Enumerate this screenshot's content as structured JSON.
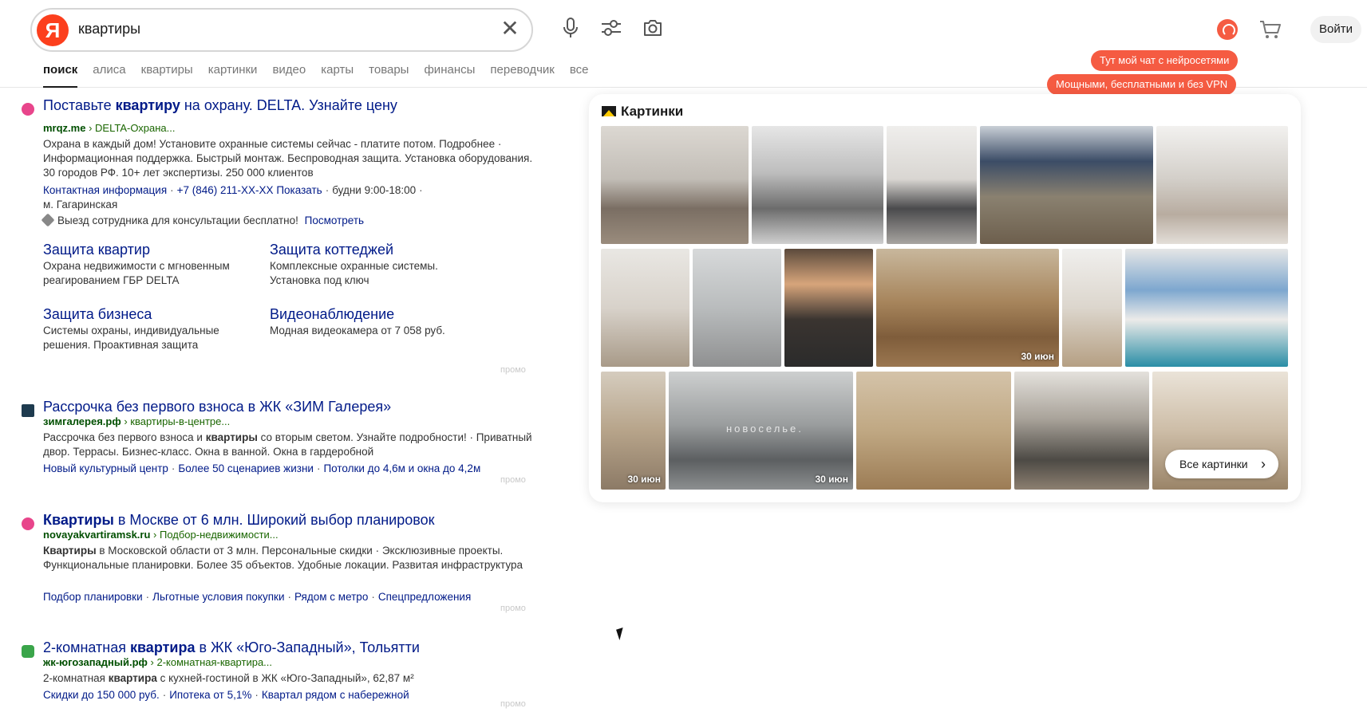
{
  "search": {
    "value": "квартиры",
    "logo": "Я"
  },
  "tabs": [
    "поиск",
    "алиса",
    "квартиры",
    "картинки",
    "видео",
    "карты",
    "товары",
    "финансы",
    "переводчик",
    "все"
  ],
  "header": {
    "login_label": "Войти"
  },
  "tooltip": {
    "line1": "Тут мой чат с нейросетями",
    "line2": "Мощными, бесплатными и без VPN"
  },
  "results": [
    {
      "title_pre": "Поставьте ",
      "title_bold": "квартиру",
      "title_post": " на охрану. DELTA. Узнайте цену",
      "domain": "mrqz.me",
      "path": " › DELTA-Охрана...",
      "desc": "Охрана в каждый дом! Установите охранные системы сейчас - платите потом. Подробнее · Информационная поддержка. Быстрый монтаж. Беспроводная защита. Установка оборудования. 30 городов РФ. 10+ лет экспертизы. 250 000 клиентов",
      "contact_link": "Контактная информация",
      "phone": "+7 (846) 211-XX-XX Показать",
      "hours": "будни 9:00-18:00",
      "metro": "м. Гагаринская",
      "offer": "Выезд сотрудника для консультации бесплатно!",
      "offer_link": "Посмотреть",
      "sitelinks": [
        {
          "title": "Защита квартир",
          "desc": "Охрана недвижимости с мгновенным реагированием ГБР DELTA"
        },
        {
          "title": "Защита коттеджей",
          "desc": "Комплексные охранные системы. Установка под ключ"
        },
        {
          "title": "Защита бизнеса",
          "desc": "Системы охраны, индивидуальные решения. Проактивная защита"
        },
        {
          "title": "Видеонаблюдение",
          "desc": "Модная видеокамера от 7 058 руб."
        }
      ],
      "promo": "промо"
    },
    {
      "title": "Рассрочка без первого взноса в ЖК «ЗИМ Галерея»",
      "domain": "зимгалерея.рф",
      "path": " › квартиры-в-центре...",
      "desc_pre": "Рассрочка без первого взноса и ",
      "desc_bold": "квартиры",
      "desc_post": " со вторым светом. Узнайте подробности! · Приватный двор. Террасы. Бизнес-класс. Окна в ванной. Окна в гардеробной",
      "links": [
        "Новый культурный центр",
        "Более 50 сценариев жизни",
        "Потолки до 4,6м и окна до 4,2м"
      ],
      "promo": "промо"
    },
    {
      "title_bold": "Квартиры",
      "title_post": " в Москве от 6 млн. Широкий выбор планировок",
      "domain": "novayakvartiramsk.ru",
      "path": " › Подбор-недвижимости...",
      "desc_bold": "Квартиры",
      "desc_post": " в Московской области от 3 млн. Персональные скидки · Эксклюзивные проекты. Функциональные планировки. Более 35 объектов. Удобные локации. Развитая инфраструктура",
      "links": [
        "Подбор планировки",
        "Льготные условия покупки",
        "Рядом с метро",
        "Спецпредложения"
      ],
      "promo": "промо"
    },
    {
      "title_pre": "2-комнатная ",
      "title_bold": "квартира",
      "title_post": " в ЖК «Юго-Западный», Тольятти",
      "domain": "жк-югозападный.рф",
      "path": " › 2-комнатная-квартира...",
      "desc_pre": "2-комнатная ",
      "desc_bold": "квартира",
      "desc_post": " с кухней-гостиной в ЖК «Юго-Западный», 62,87 м²",
      "links": [
        "Скидки до 150 000 руб.",
        "Ипотека от 5,1%",
        "Квартал рядом с набережной"
      ],
      "promo": "промо"
    }
  ],
  "images": {
    "title": "Картинки",
    "all_label": "Все картинки",
    "dates": [
      "30 июн",
      "30 июн",
      "30 июн"
    ],
    "watermark": "новоселье."
  },
  "colors": {
    "accent": "#fc3f1d",
    "link": "#001a88",
    "url": "#1a7a00",
    "bubble": "#f55b42"
  }
}
